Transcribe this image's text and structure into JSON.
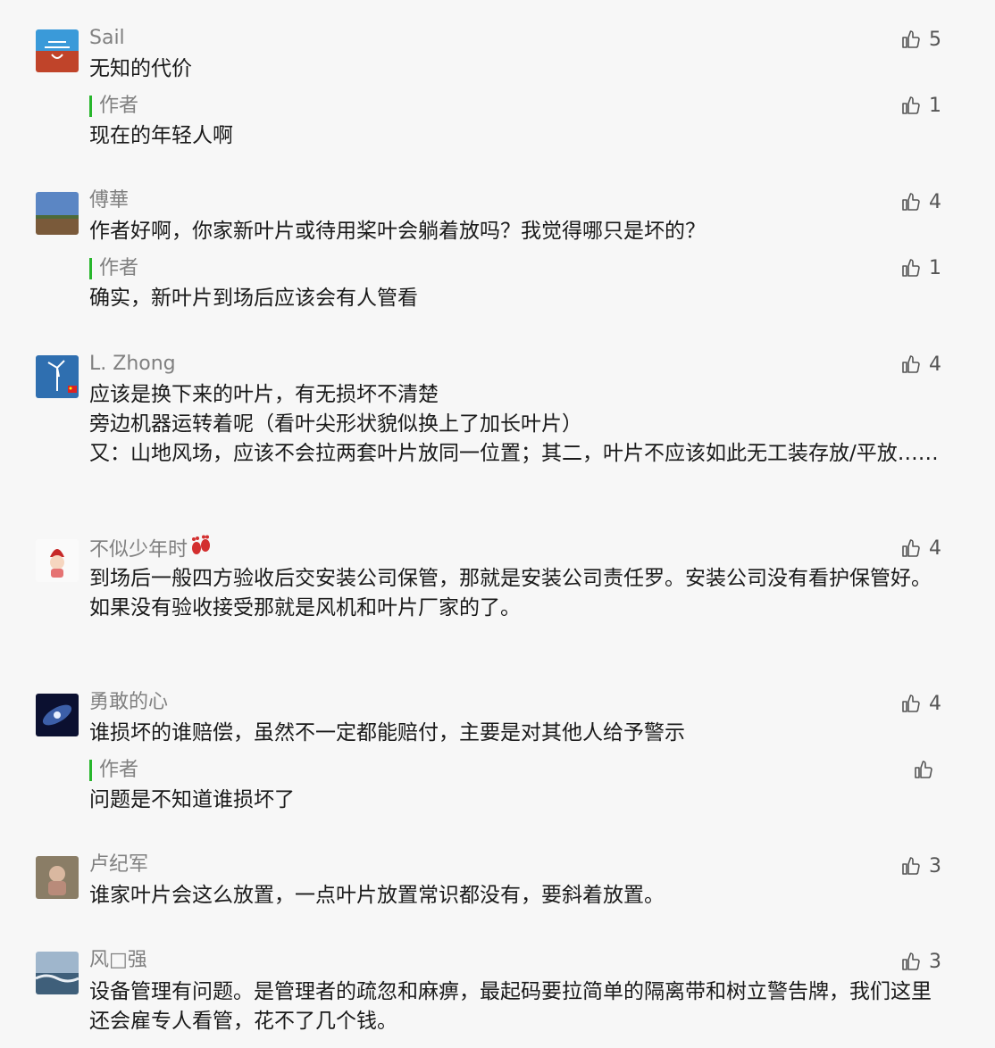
{
  "comments": [
    {
      "nickname": "Sail",
      "text": "无知的代价",
      "likes": "5",
      "avatar_icon": "sailboat-sunset-icon",
      "reply": {
        "label": "作者",
        "text": "现在的年轻人啊",
        "likes": "1"
      }
    },
    {
      "nickname": "傅華",
      "text": "作者好啊，你家新叶片或待用桨叶会躺着放吗？我觉得哪只是坏的？",
      "likes": "4",
      "avatar_icon": "landscape-photo-icon",
      "reply": {
        "label": "作者",
        "text": "确实，新叶片到场后应该会有人管看",
        "likes": "1"
      }
    },
    {
      "nickname": "L. Zhong",
      "text": "应该是换下来的叶片，有无损坏不清楚\n旁边机器运转着呢（看叶尖形状貌似换上了加长叶片）\n又：山地风场，应该不会拉两套叶片放同一位置；其二，叶片不应该如此无工装存放/平放……",
      "likes": "4",
      "avatar_icon": "wind-turbine-icon"
    },
    {
      "nickname": "不似少年时",
      "nickname_emoji": "footprints-icon",
      "text": "到场后一般四方验收后交安装公司保管，那就是安装公司责任罗。安装公司没有看护保管好。\n如果没有验收接受那就是风机和叶片厂家的了。",
      "likes": "4",
      "avatar_icon": "cartoon-girl-icon"
    },
    {
      "nickname": "勇敢的心",
      "text": "谁损坏的谁赔偿，虽然不一定都能赔付，主要是对其他人给予警示",
      "likes": "4",
      "avatar_icon": "galaxy-icon",
      "reply": {
        "label": "作者",
        "text": "问题是不知道谁损坏了",
        "likes": ""
      }
    },
    {
      "nickname": "卢纪军",
      "text": "谁家叶片会这么放置，一点叶片放置常识都没有，要斜着放置。",
      "likes": "3",
      "avatar_icon": "child-photo-icon"
    },
    {
      "nickname": "风□强",
      "text": "设备管理有问题。是管理者的疏忽和麻痹，最起码要拉简单的隔离带和树立警告牌，我们这里还会雇专人看管，花不了几个钱。",
      "likes": "3",
      "avatar_icon": "seascape-photo-icon"
    }
  ],
  "colors": {
    "accent_green": "#28b62c",
    "nickname_gray": "#808080",
    "background": "#f7f7f7"
  }
}
